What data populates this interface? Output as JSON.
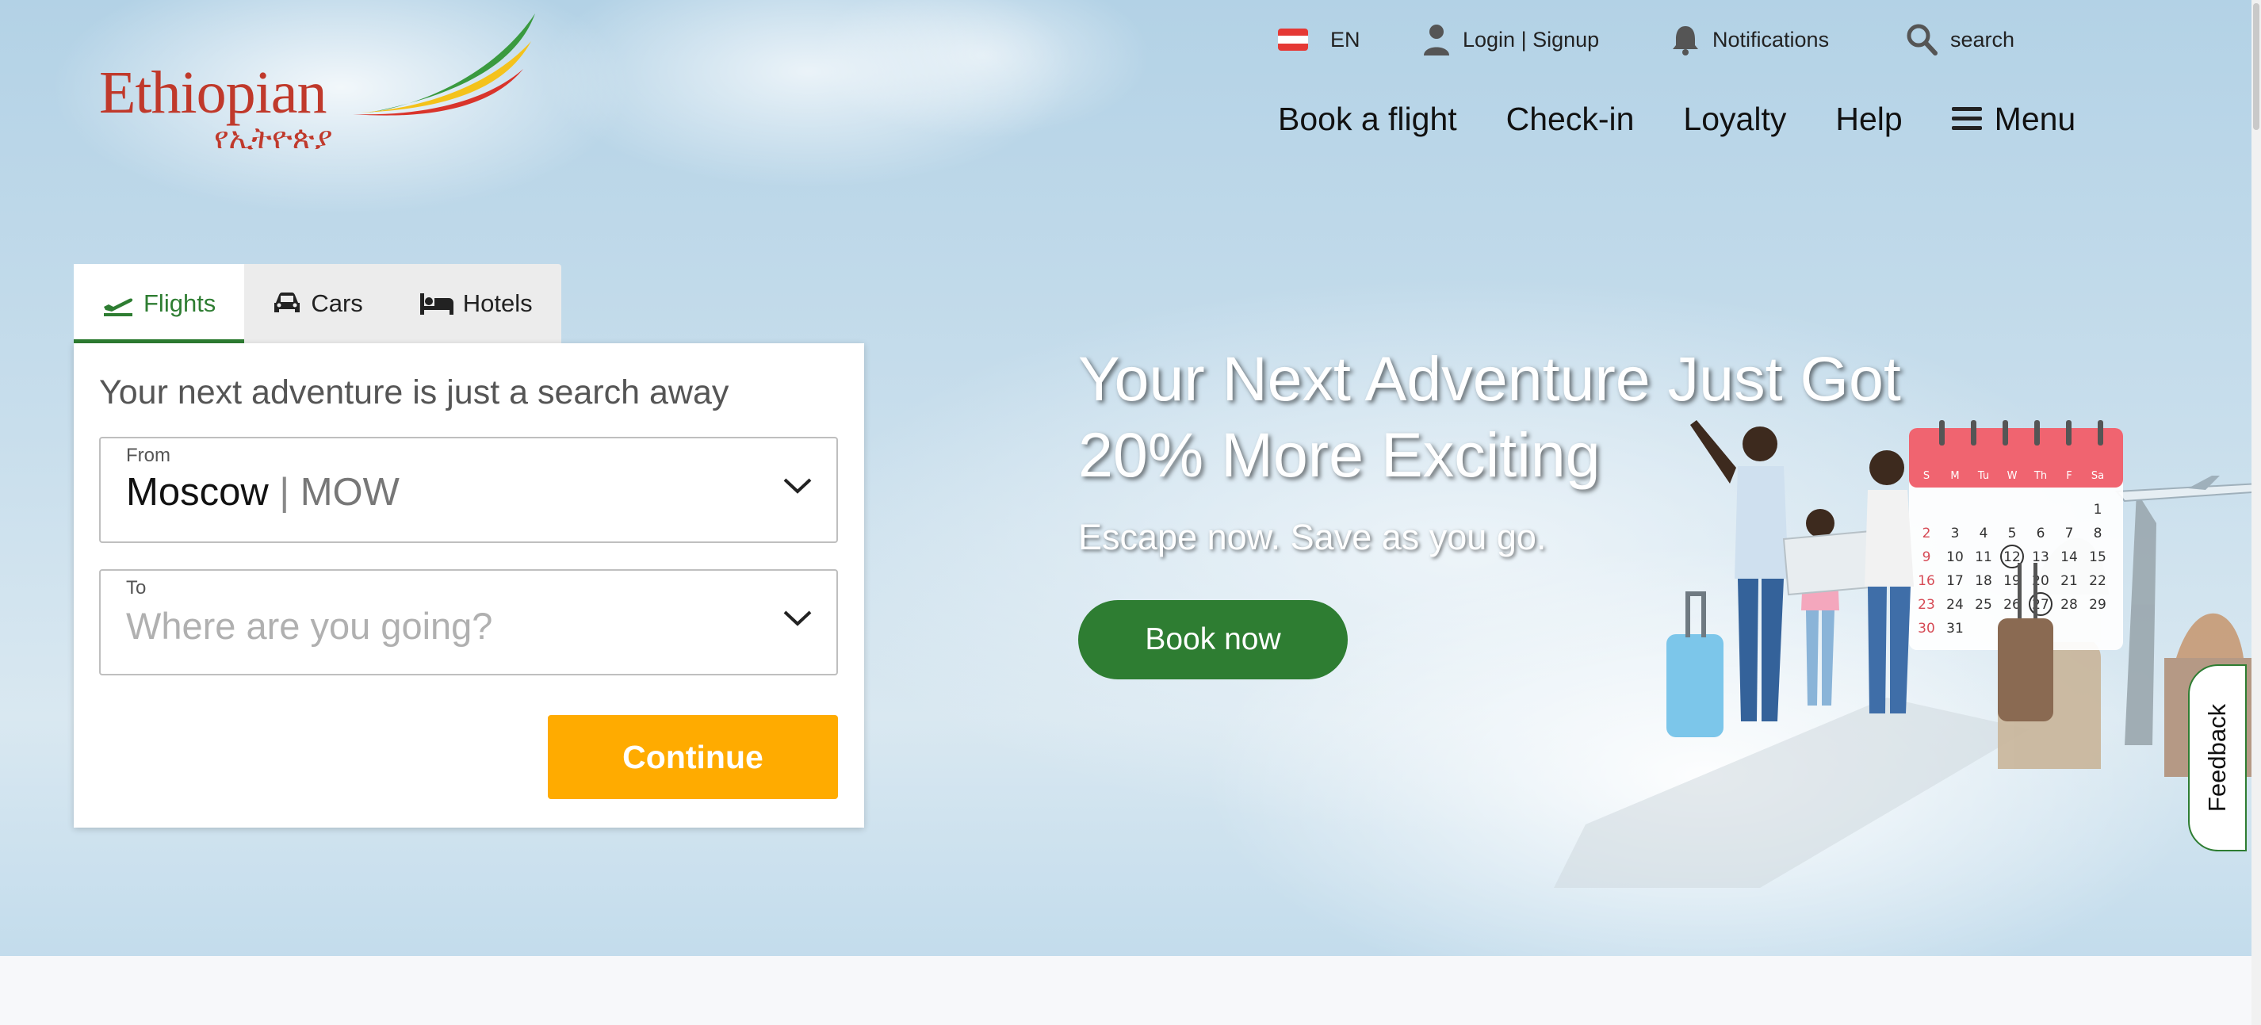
{
  "brand": {
    "name": "Ethiopian",
    "amharic": "የኢትዮጵያ",
    "primary_color": "#2e7d32",
    "accent_color": "#ffab00",
    "logo_color": "#c0392b"
  },
  "header": {
    "language": {
      "code": "EN",
      "icon": "flag-icon"
    },
    "login_label": "Login | Signup",
    "notifications_label": "Notifications",
    "search_label": "search"
  },
  "nav": {
    "items": [
      "Book a flight",
      "Check-in",
      "Loyalty",
      "Help"
    ],
    "menu_label": "Menu"
  },
  "booking": {
    "tabs": [
      {
        "label": "Flights",
        "icon": "plane-icon",
        "active": true
      },
      {
        "label": "Cars",
        "icon": "car-icon",
        "active": false
      },
      {
        "label": "Hotels",
        "icon": "bed-icon",
        "active": false
      }
    ],
    "title": "Your next adventure is just a search away",
    "from": {
      "label": "From",
      "city": "Moscow",
      "separator": "|",
      "code": "MOW"
    },
    "to": {
      "label": "To",
      "placeholder": "Where are you going?"
    },
    "continue_label": "Continue"
  },
  "promo": {
    "title_line1": "Your Next Adventure Just Got",
    "title_line2": "20% More Exciting",
    "subtitle": "Escape now. Save as you go.",
    "cta_label": "Book now"
  },
  "calendar": {
    "days": [
      "S",
      "M",
      "Tu",
      "W",
      "Th",
      "F",
      "Sa"
    ],
    "weeks": [
      [
        "",
        "",
        "",
        "",
        "",
        "",
        "1"
      ],
      [
        "2",
        "3",
        "4",
        "5",
        "6",
        "7",
        "8"
      ],
      [
        "9",
        "10",
        "11",
        "12",
        "13",
        "14",
        "15"
      ],
      [
        "16",
        "17",
        "18",
        "19",
        "20",
        "21",
        "22"
      ],
      [
        "23",
        "24",
        "25",
        "26",
        "27",
        "28",
        "29"
      ],
      [
        "30",
        "31",
        "",
        "",
        "",
        "",
        ""
      ]
    ],
    "circled": [
      "12",
      "27"
    ]
  },
  "feedback_label": "Feedback"
}
